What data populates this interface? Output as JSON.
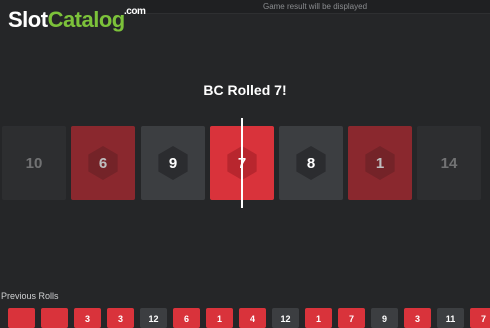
{
  "top_bar": {
    "message": "Game result will be displayed"
  },
  "logo": {
    "part1": "Slot",
    "part2": "Catalog",
    "suffix": ".com"
  },
  "result": {
    "title": "BC Rolled 7!"
  },
  "reel": {
    "cards": [
      {
        "value": "10",
        "color": "grey",
        "fade": "hard",
        "hex": false
      },
      {
        "value": "6",
        "color": "red",
        "fade": "soft-dim",
        "hex": true
      },
      {
        "value": "9",
        "color": "grey",
        "fade": "none",
        "hex": true
      },
      {
        "value": "7",
        "color": "red",
        "fade": "none",
        "hex": true
      },
      {
        "value": "8",
        "color": "grey",
        "fade": "none",
        "hex": true
      },
      {
        "value": "1",
        "color": "red",
        "fade": "soft-dim",
        "hex": true
      },
      {
        "value": "14",
        "color": "grey",
        "fade": "hard",
        "hex": false
      }
    ]
  },
  "previous_rolls": {
    "label": "Previous Rolls",
    "items": [
      {
        "value": "",
        "color": "red"
      },
      {
        "value": "",
        "color": "red"
      },
      {
        "value": "3",
        "color": "red"
      },
      {
        "value": "3",
        "color": "red"
      },
      {
        "value": "12",
        "color": "grey"
      },
      {
        "value": "6",
        "color": "red"
      },
      {
        "value": "1",
        "color": "red"
      },
      {
        "value": "4",
        "color": "red"
      },
      {
        "value": "12",
        "color": "grey"
      },
      {
        "value": "1",
        "color": "red"
      },
      {
        "value": "7",
        "color": "red"
      },
      {
        "value": "9",
        "color": "grey"
      },
      {
        "value": "3",
        "color": "red"
      },
      {
        "value": "11",
        "color": "grey"
      },
      {
        "value": "7",
        "color": "red"
      }
    ]
  },
  "colors": {
    "red": "#d9333b",
    "grey": "#3c3e41",
    "background": "#252628",
    "brand_green": "#7cc23a"
  }
}
